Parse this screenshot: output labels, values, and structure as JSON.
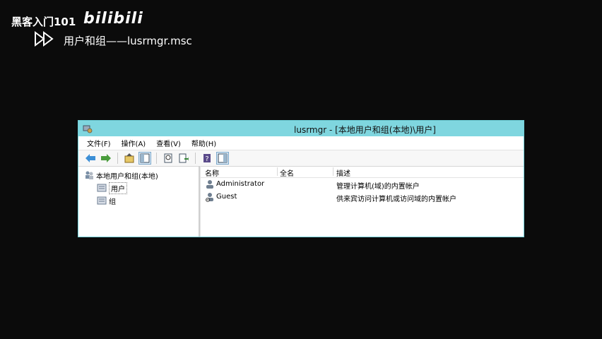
{
  "overlay": {
    "brand": "黑客入门101",
    "logo_text": "bilibili",
    "subtitle": "用户和组——lusrmgr.msc"
  },
  "window": {
    "title": "lusrmgr - [本地用户和组(本地)\\用户]",
    "menu": [
      "文件(F)",
      "操作(A)",
      "查看(V)",
      "帮助(H)"
    ],
    "toolbar_icons": [
      "back-arrow-icon",
      "forward-arrow-icon",
      "up-folder-icon",
      "show-hide-tree-icon",
      "properties-icon",
      "export-list-icon",
      "help-icon",
      "show-hide-action-pane-icon"
    ]
  },
  "tree": {
    "root": "本地用户和组(本地)",
    "children": [
      "用户",
      "组"
    ],
    "selected": "用户"
  },
  "list": {
    "columns": [
      "名称",
      "全名",
      "描述"
    ],
    "rows": [
      {
        "name": "Administrator",
        "fullname": "",
        "description": "管理计算机(域)的内置帐户"
      },
      {
        "name": "Guest",
        "fullname": "",
        "description": "供来宾访问计算机或访问域的内置帐户"
      }
    ]
  },
  "colors": {
    "titlebar": "#7fd6df",
    "window_border": "#6fcfd8",
    "background": "#0b0b0b"
  }
}
